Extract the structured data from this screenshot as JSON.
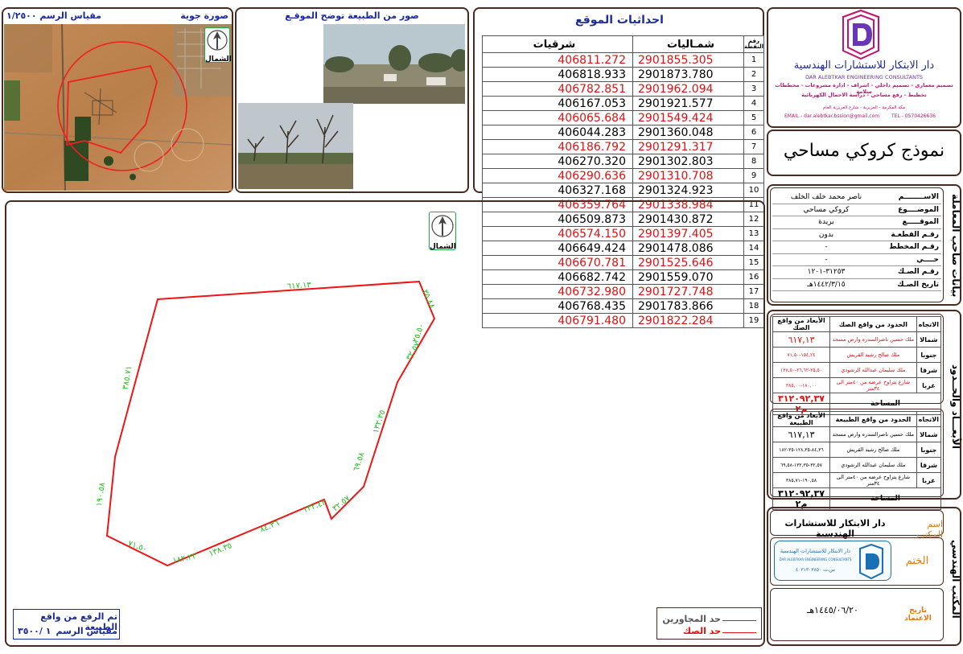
{
  "aerial": {
    "title": "صورة جوية",
    "scale": "مقياس الرسم ١/٢٥٠٠"
  },
  "photos": {
    "title": "صور من الطبيعة توضح الموقـع"
  },
  "north_label": "الشمال",
  "coords": {
    "title": "احداثيات الموقع",
    "col_east": "شرقيات",
    "col_north": "شمـاليات",
    "col_point": "رقم النقطة",
    "rows": [
      {
        "n": "1",
        "north": "2901855.305",
        "east": "406811.272",
        "red": true
      },
      {
        "n": "2",
        "north": "2901873.780",
        "east": "406818.933",
        "red": false
      },
      {
        "n": "3",
        "north": "2901962.094",
        "east": "406782.851",
        "red": true
      },
      {
        "n": "4",
        "north": "2901921.577",
        "east": "406167.053",
        "red": false
      },
      {
        "n": "5",
        "north": "2901549.424",
        "east": "406065.684",
        "red": true
      },
      {
        "n": "6",
        "north": "2901360.048",
        "east": "406044.283",
        "red": false
      },
      {
        "n": "7",
        "north": "2901291.317",
        "east": "406186.792",
        "red": true
      },
      {
        "n": "8",
        "north": "2901302.803",
        "east": "406270.320",
        "red": false
      },
      {
        "n": "9",
        "north": "2901310.708",
        "east": "406290.636",
        "red": true
      },
      {
        "n": "10",
        "north": "2901324.923",
        "east": "406327.168",
        "red": false
      },
      {
        "n": "11",
        "north": "2901338.984",
        "east": "406359.764",
        "red": true
      },
      {
        "n": "12",
        "north": "2901430.872",
        "east": "406509.873",
        "red": false
      },
      {
        "n": "13",
        "north": "2901397.405",
        "east": "406574.150",
        "red": true
      },
      {
        "n": "14",
        "north": "2901478.086",
        "east": "406649.424",
        "red": false
      },
      {
        "n": "15",
        "north": "2901525.646",
        "east": "406670.781",
        "red": true
      },
      {
        "n": "16",
        "north": "2901559.070",
        "east": "406682.742",
        "red": false
      },
      {
        "n": "17",
        "north": "2901727.748",
        "east": "406732.980",
        "red": true
      },
      {
        "n": "18",
        "north": "2901783.866",
        "east": "406768.435",
        "red": false
      },
      {
        "n": "19",
        "north": "2901822.284",
        "east": "406791.480",
        "red": true
      }
    ]
  },
  "company": {
    "name_ar": "دار الابتكار للاستشارات الهندسية",
    "name_en": "DAR ALEBTKAR ENGINEERING CONSULTANTS",
    "services_1": "تصميم معماري - تصميم داخلي - اشراف - ادارة مشروعات - مخططات سلامة",
    "services_2": "تخطيط - رفع مساحي - دراسة الاحمال الكهربائية",
    "address": "مكة المكرمة - العزيزية - شارع العزيزية العام",
    "email": "EMAIL - dar.alebtkar.bssion@gmail.com",
    "tel": "TEL - 0570426636"
  },
  "form_title": "نموذج كروكي مساحي",
  "owner": {
    "section_label": "بيانات صاحب المعاملة",
    "rows": [
      {
        "label": "الاســــــــم",
        "value": "ناصر محمد خلف الخلف"
      },
      {
        "label": "الموضــــوع",
        "value": "كروكي مساحي"
      },
      {
        "label": "الموقـــــع",
        "value": "بريدة"
      },
      {
        "label": "رقـم القطعـة",
        "value": "بدون"
      },
      {
        "label": "رقـم المخطط",
        "value": "-"
      },
      {
        "label": "حــــي",
        "value": "-"
      },
      {
        "label": "رقـم الصـك",
        "value": "٣١٢٥٣-١٢٠١"
      },
      {
        "label": "تاريخ الصـك",
        "value": "١٤٤٢/٣/١٥هـ"
      }
    ]
  },
  "bounds": {
    "section_label": "الأبعـــاد والحــدود",
    "h_dir": "الاتجاه",
    "h_deed": "الحدود من واقع الصك",
    "h_deed_dims": "الأبعاد من واقع الصك",
    "h_nature": "الحدود من واقع الطبيعة",
    "h_nature_dims": "الأبعاد من واقع الطبيعة",
    "area_label": "المساحة",
    "deed_rows": [
      {
        "dir": "شمالا",
        "boundary": "ملك حسين ناصرالسدره وارض مسجد",
        "dims": "٦١٧,١٣"
      },
      {
        "dir": "جنوبا",
        "boundary": "ملك صالح رشيد القريش",
        "dims": "١٥٤,٢٤-٧١,٥٠"
      },
      {
        "dir": "شرقا",
        "boundary": "ملك سليمان عبدالله الرشودي",
        "dims": "٢٥,٥٠-٢٦,٦٢-١٣٨,٥٠"
      },
      {
        "dir": "غربا",
        "boundary": "شارع يتراوح عرضه من ٤٠متر الى ٣٤متر",
        "dims": "١٨٠,٠٠-٣٨٥,٠٠"
      }
    ],
    "deed_area": "٣١٢٠٩٢,٣٧ م٢",
    "nature_rows": [
      {
        "dir": "شمالا",
        "boundary": "ملك حسين ناصرالسدره وارض مسجد",
        "dims": "٦١٧,١٣"
      },
      {
        "dir": "جنوبا",
        "boundary": "ملك صالح رشيد القريش",
        "dims": "٨٤,٣٦-١٢٨,٣٥-٣٥-١٨٢"
      },
      {
        "dir": "شرقا",
        "boundary": "ملك سليمان عبدالله الرشودي",
        "dims": "٣٢,٥٧-١٣٢,٣٥-٦٩,٥٨"
      },
      {
        "dir": "غربا",
        "boundary": "شارع يتراوح عرضه من ٤٠متر الى ٣٤متر",
        "dims": "١٩٠,٥٨-٣٨٥,٧١"
      }
    ],
    "nature_area": "٣١٢٠٩٢,٣٧ م٢"
  },
  "office": {
    "section_label": "المكتب الهندسي",
    "name_label": "اسم المكتب",
    "name_value": "دار الابتكار للاستشارات الهندسية",
    "stamp_label": "الختم",
    "date_label": "تاريخ الاعتماد",
    "date_value": "١٤٤٥/٠٦/٢٠هـ",
    "stamp_name": "دار الابتكار للاستشارات الهندسية",
    "stamp_en": "DAR ALEBTKAR ENGINEERING CONSULTANTS",
    "stamp_no": "س.ت ٤٠٣١٣٠٣٨٥٠"
  },
  "survey": {
    "note": "تم الرفع من واقع الطبيعة",
    "scale_label": "مقياس الرسم",
    "scale_value": "١ /٣٥٠٠"
  },
  "legend": {
    "neighbors": "حد المجاورين",
    "deed": "حد الصك"
  },
  "plot": {
    "edge_labels": [
      "٦١٧.١٣",
      "٣٥.٨٨",
      "٣٢.٥٧",
      "١٣٢.٣٥",
      "٦٩.٥٨",
      "٣٢.٥٧",
      "١٣٢.٤٢",
      "٨٤.٣٦",
      "١٣٨.٣٥",
      "١٨٢.٢٣",
      "٧١.٥٠",
      "١٩٠.٥٨",
      "٣٨٥.٧١",
      "٢٥.٥٠"
    ]
  },
  "colors": {
    "red": "#e01010",
    "frame": "#4a2a1e",
    "blue": "#1b2a9c",
    "green_labels": "#1fbf1f",
    "magenta": "#c8106e"
  }
}
